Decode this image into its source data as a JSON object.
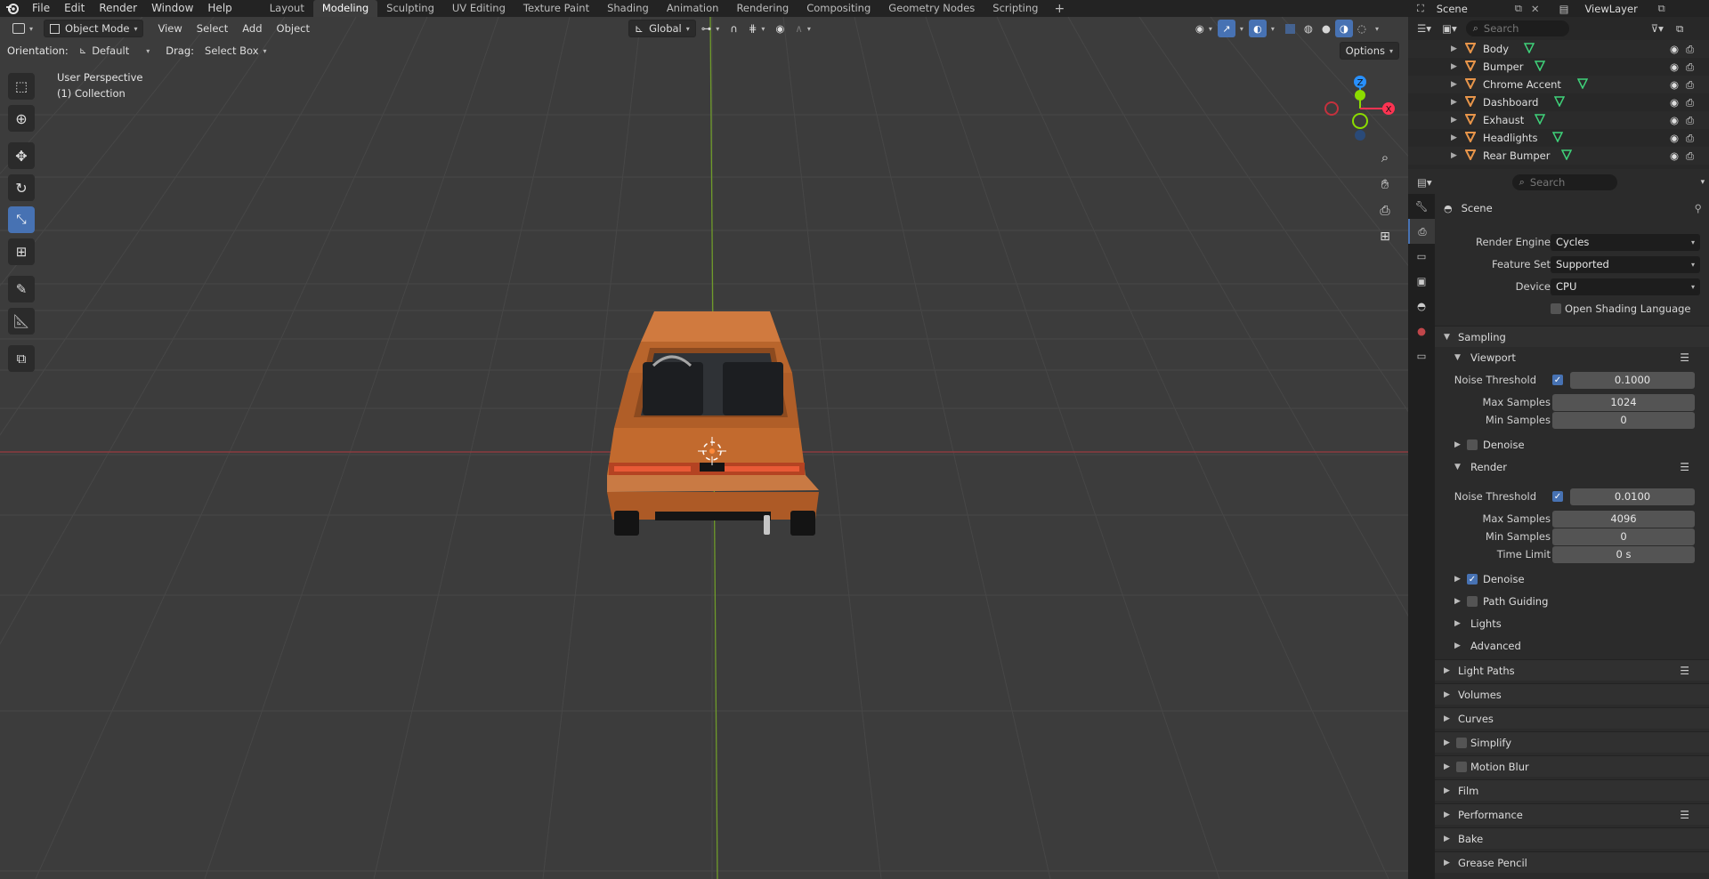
{
  "menus": [
    "File",
    "Edit",
    "Render",
    "Window",
    "Help"
  ],
  "workspaces": [
    "Layout",
    "Modeling",
    "Sculpting",
    "UV Editing",
    "Texture Paint",
    "Shading",
    "Animation",
    "Rendering",
    "Compositing",
    "Geometry Nodes",
    "Scripting"
  ],
  "active_workspace": "Modeling",
  "viewport_header": {
    "mode": "Object Mode",
    "menus": [
      "View",
      "Select",
      "Add",
      "Object"
    ],
    "transform_orientation": "Global"
  },
  "tool_settings": {
    "orientation_label": "Orientation:",
    "orientation_value": "Default",
    "drag_label": "Drag:",
    "drag_value": "Select Box",
    "options": "Options"
  },
  "viewport_overlay": {
    "view_name": "User Perspective",
    "collection": "(1) Collection"
  },
  "gizmo": {
    "z": "Z",
    "y": "Y",
    "x": "X"
  },
  "outliner": {
    "scene": "Scene",
    "view_layer": "ViewLayer",
    "search_placeholder": "Search",
    "items": [
      {
        "label": "Body"
      },
      {
        "label": "Bumper"
      },
      {
        "label": "Chrome Accent"
      },
      {
        "label": "Dashboard"
      },
      {
        "label": "Exhaust"
      },
      {
        "label": "Headlights"
      },
      {
        "label": "Rear Bumper"
      }
    ]
  },
  "properties": {
    "search_placeholder": "Search",
    "context": "Scene",
    "render_engine_label": "Render Engine",
    "render_engine": "Cycles",
    "feature_set_label": "Feature Set",
    "feature_set": "Supported",
    "device_label": "Device",
    "device": "CPU",
    "osl_label": "Open Shading Language",
    "sampling": "Sampling",
    "viewport": "Viewport",
    "noise_threshold_label": "Noise Threshold",
    "vp_noise_threshold": "0.1000",
    "max_samples_label": "Max Samples",
    "vp_max_samples": "1024",
    "min_samples_label": "Min Samples",
    "vp_min_samples": "0",
    "denoise_label": "Denoise",
    "render": "Render",
    "r_noise_threshold": "0.0100",
    "r_max_samples": "4096",
    "r_min_samples": "0",
    "time_limit_label": "Time Limit",
    "r_time_limit": "0 s",
    "path_guiding": "Path Guiding",
    "lights": "Lights",
    "advanced": "Advanced",
    "panels": [
      "Light Paths",
      "Volumes",
      "Curves",
      "Simplify",
      "Motion Blur",
      "Film",
      "Performance",
      "Bake",
      "Grease Pencil"
    ]
  },
  "colors": {
    "accent": "#4772b3",
    "car_body": "#c8692a",
    "x_axis": "#ff3352",
    "y_axis": "#8bdc00",
    "z_axis": "#2890ff",
    "object_icon": "#e8954a",
    "mesh_icon": "#3fd27a"
  }
}
